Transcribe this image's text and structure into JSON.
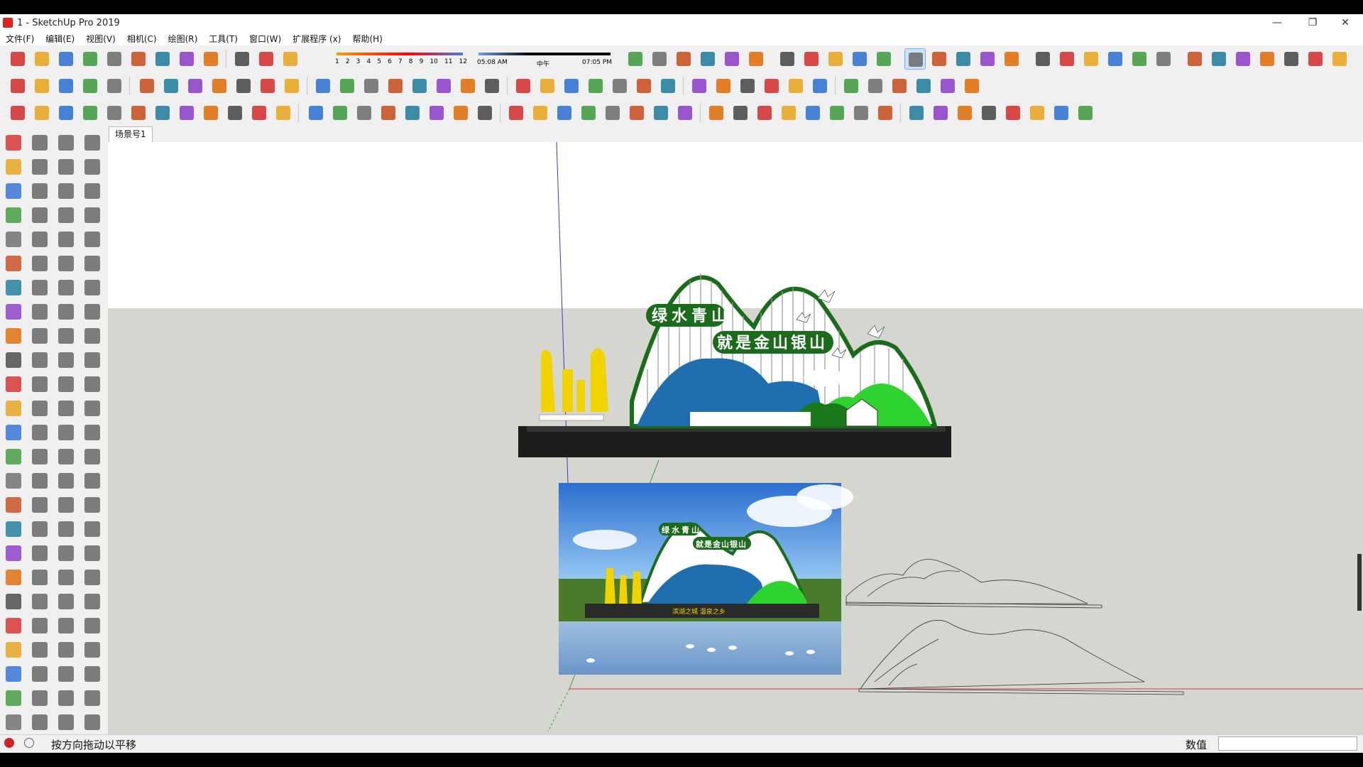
{
  "window": {
    "title": "1 - SketchUp Pro 2019"
  },
  "menus": [
    "文件(F)",
    "编辑(E)",
    "视图(V)",
    "相机(C)",
    "绘图(R)",
    "工具(T)",
    "窗口(W)",
    "扩展程序 (x)",
    "帮助(H)"
  ],
  "shadow_settings": {
    "months": [
      "1",
      "2",
      "3",
      "4",
      "5",
      "6",
      "7",
      "8",
      "9",
      "10",
      "11",
      "12"
    ],
    "sunrise_time": "05:08 AM",
    "noon_label": "中午",
    "sunset_time": "07:05 PM"
  },
  "scene_tabs": [
    "场景号1"
  ],
  "model": {
    "sign_text_line1": "绿水青山",
    "sign_text_line2": "就是金山银山",
    "render_line1": "绿水青山",
    "render_line2": "就是金山银山",
    "render_base_text": "滨湖之城  温泉之乡"
  },
  "status": {
    "hint": "按方向拖动以平移",
    "measurements_label": "数值",
    "measurements_value": ""
  },
  "colors": {
    "brand": "#d42a2a",
    "viewport_sky": "#ffffff",
    "viewport_ground": "#d6d6d0",
    "sign_green": "#1a6b1a",
    "sign_blue": "#1f6fb0",
    "sign_yellow": "#f1d300",
    "lime": "#2fd32f"
  },
  "icons": {
    "toolbar_row1": [
      "new-file-icon",
      "open-file-icon",
      "save-icon",
      "cut-icon",
      "copy-icon",
      "paste-icon",
      "erase-icon",
      "undo-icon",
      "redo-icon",
      "print-icon",
      "model-info-icon",
      "shadow-toggle-icon",
      "iso-view-icon",
      "top-view-icon",
      "front-view-icon",
      "right-view-icon",
      "back-view-icon",
      "left-view-icon",
      "xray-icon",
      "back-edges-icon",
      "wireframe-icon",
      "hidden-line-icon",
      "shaded-icon",
      "shaded-texture-icon",
      "monochrome-icon",
      "sandbox-from-contours-icon",
      "sandbox-from-scratch-icon",
      "smoove-icon",
      "stamp-icon",
      "drape-icon",
      "add-detail-icon",
      "flip-edge-icon",
      "section-plane-icon",
      "display-sections-icon",
      "section-cuts-icon",
      "section-fill-icon",
      "extension-a-icon",
      "extension-b-icon",
      "extension-c-icon",
      "extension-d-icon",
      "extension-e-icon",
      "extension-f-icon",
      "extension-g-icon"
    ],
    "toolbar_row2": [
      "select-icon",
      "make-component-icon",
      "paint-bucket-icon",
      "eraser-icon",
      "line-icon",
      "arc-icon",
      "rectangle-icon",
      "circle-icon",
      "polygon-icon",
      "freehand-icon",
      "move-icon",
      "push-pull-icon",
      "rotate-icon",
      "follow-me-icon",
      "scale-icon",
      "offset-icon",
      "tape-measure-icon",
      "dimension-icon",
      "protractor-icon",
      "text-icon",
      "axes-icon",
      "3d-text-icon",
      "orbit-icon",
      "pan-icon",
      "zoom-icon",
      "zoom-window-icon",
      "zoom-extents-icon",
      "previous-view-icon",
      "position-camera-icon",
      "look-around-icon",
      "walk-icon",
      "warehouse-icon",
      "extension-warehouse-icon",
      "layout-icon",
      "style-builder-icon",
      "arrow-red-icon",
      "arrow-blue-icon",
      "arrow-green-icon",
      "arrow-orange-icon"
    ],
    "toolbar_row3": [
      "mirror-icon",
      "curve-icon",
      "extrude-icon",
      "shape-icon",
      "cube-icon",
      "box-icon",
      "grid-icon",
      "fps-icon",
      "fe-icon",
      "pointer-icon",
      "color-picker-icon",
      "material-icon",
      "bezier-icon",
      "polyline-icon",
      "spline-icon",
      "catmull-icon",
      "explode-icon",
      "joint-push-icon",
      "triangulate-icon",
      "fold-icon",
      "hat-icon",
      "soften-icon",
      "cross-icon",
      "tangent-icon",
      "connect-icon",
      "shield-icon",
      "weld-icon",
      "tree-icon",
      "select-tool-icon",
      "lasso-icon",
      "pan-tool-icon",
      "arc-tool-icon",
      "rope-icon",
      "curvizard-icon",
      "num-icon",
      "line-tool-icon",
      "vase-icon",
      "paint-icon",
      "shell-icon",
      "cube-blue-icon",
      "clapper-icon",
      "screen-icon",
      "align-icon",
      "stamp-tool-icon"
    ]
  }
}
